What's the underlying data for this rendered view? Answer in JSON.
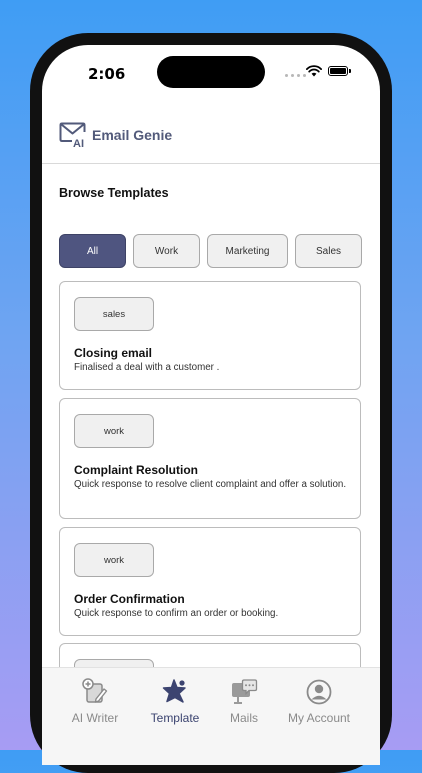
{
  "status_bar": {
    "time": "2:06"
  },
  "app": {
    "title": "Email Genie",
    "logo_text": "AI"
  },
  "browse": {
    "title": "Browse Templates",
    "filters": [
      {
        "label": "All",
        "active": true
      },
      {
        "label": "Work",
        "active": false
      },
      {
        "label": "Marketing",
        "active": false
      },
      {
        "label": "Sales",
        "active": false
      }
    ]
  },
  "templates": [
    {
      "tag": "sales",
      "title": "Closing email",
      "description": "Finalised a deal with a customer ."
    },
    {
      "tag": "work",
      "title": "Complaint Resolution",
      "description": "Quick response to resolve client complaint and offer a solution."
    },
    {
      "tag": "work",
      "title": "Order Confirmation",
      "description": "Quick response to confirm an order or booking."
    }
  ],
  "tabbar": {
    "items": [
      {
        "label": "AI Writer",
        "icon": "ai-writer-icon",
        "active": false
      },
      {
        "label": "Template",
        "icon": "star-icon",
        "active": true
      },
      {
        "label": "Mails",
        "icon": "mail-chat-icon",
        "active": false
      },
      {
        "label": "My Account",
        "icon": "user-icon",
        "active": false
      }
    ]
  },
  "colors": {
    "accent": "#4f5580",
    "active_tab": "#3c4470",
    "inactive_tab": "#8a8a8a"
  }
}
